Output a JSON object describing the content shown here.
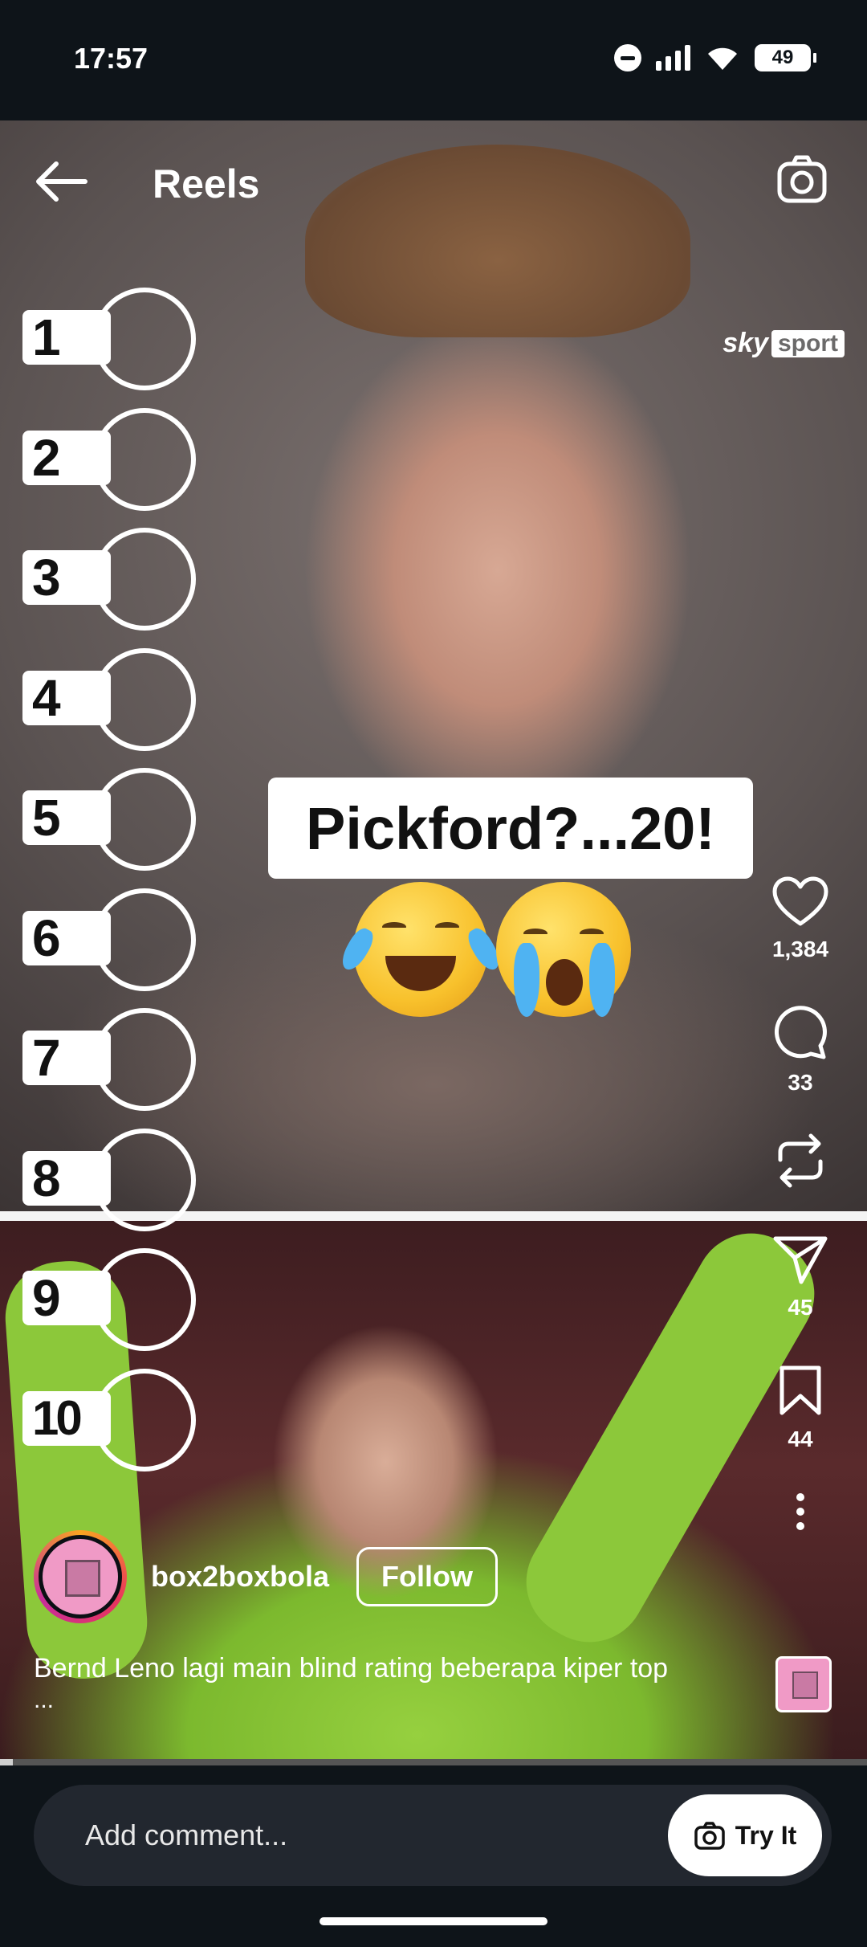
{
  "status_bar": {
    "time": "17:57",
    "battery": "49"
  },
  "header": {
    "title": "Reels"
  },
  "video": {
    "watermark_brand": "sky",
    "watermark_product": "sport",
    "ranking_labels": [
      "1",
      "2",
      "3",
      "4",
      "5",
      "6",
      "7",
      "8",
      "9",
      "10"
    ],
    "caption": "Pickford?...20!",
    "emojis": [
      "tears-of-joy",
      "loudly-crying"
    ]
  },
  "actions": {
    "like_count": "1,384",
    "comment_count": "33",
    "share_count": "45",
    "save_count": "44"
  },
  "author": {
    "username": "box2boxbola",
    "follow_label": "Follow"
  },
  "description": {
    "text": "Bernd Leno lagi main blind rating beberapa kiper top",
    "more": "..."
  },
  "progress": {
    "fraction": 0.015
  },
  "comment_bar": {
    "placeholder": "Add comment...",
    "try_it_label": "Try It"
  },
  "colors": {
    "background": "#0e1419",
    "caption_bg": "#ffffff",
    "comment_pill": "#22272f"
  }
}
